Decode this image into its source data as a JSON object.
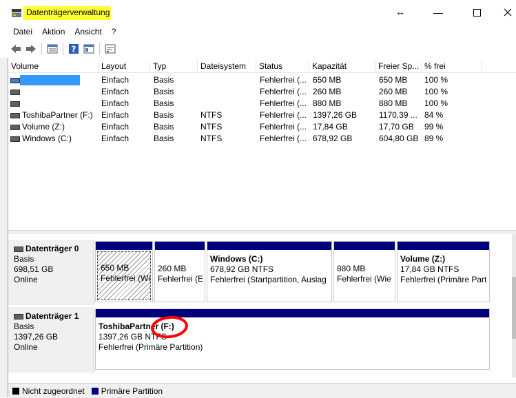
{
  "window": {
    "title": "Datenträgerverwaltung",
    "title_highlight_color": "#ffff33",
    "controls": [
      "minimize",
      "maximize",
      "close"
    ]
  },
  "menu": [
    {
      "label": "Datei"
    },
    {
      "label": "Aktion"
    },
    {
      "label": "Ansicht"
    },
    {
      "label": "?"
    }
  ],
  "toolbar": {
    "buttons": [
      "back-icon",
      "forward-icon",
      "disk-list-icon",
      "help-icon",
      "properties-icon",
      "settings-icon"
    ]
  },
  "volume_table": {
    "columns": [
      "Volume",
      "Layout",
      "Typ",
      "Dateisystem",
      "Status",
      "Kapazität",
      "Freier Sp...",
      "% frei"
    ],
    "rows": [
      {
        "volume": "",
        "layout": "Einfach",
        "typ": "Basis",
        "fs": "",
        "status": "Fehlerfrei (...",
        "cap": "650 MB",
        "free": "650 MB",
        "pct": "100 %",
        "selected": true
      },
      {
        "volume": "",
        "layout": "Einfach",
        "typ": "Basis",
        "fs": "",
        "status": "Fehlerfrei (...",
        "cap": "260 MB",
        "free": "260 MB",
        "pct": "100 %",
        "selected": false
      },
      {
        "volume": "",
        "layout": "Einfach",
        "typ": "Basis",
        "fs": "",
        "status": "Fehlerfrei (...",
        "cap": "880 MB",
        "free": "880 MB",
        "pct": "100 %",
        "selected": false
      },
      {
        "volume": "ToshibaPartner (F:)",
        "layout": "Einfach",
        "typ": "Basis",
        "fs": "NTFS",
        "status": "Fehlerfrei (...",
        "cap": "1397,26 GB",
        "free": "1170,39 ...",
        "pct": "84 %",
        "selected": false
      },
      {
        "volume": "Volume (Z:)",
        "layout": "Einfach",
        "typ": "Basis",
        "fs": "NTFS",
        "status": "Fehlerfrei (...",
        "cap": "17,84 GB",
        "free": "17,70 GB",
        "pct": "99 %",
        "selected": false
      },
      {
        "volume": "Windows (C:)",
        "layout": "Einfach",
        "typ": "Basis",
        "fs": "NTFS",
        "status": "Fehlerfrei (...",
        "cap": "678,92 GB",
        "free": "604,80 GB",
        "pct": "89 %",
        "selected": false
      }
    ]
  },
  "disks": [
    {
      "name": "Datenträger 0",
      "type": "Basis",
      "size": "698,51 GB",
      "state": "Online",
      "partitions": [
        {
          "name": "",
          "line1": "650 MB",
          "line2": "Fehlerfrei (Wie",
          "selected": true
        },
        {
          "name": "",
          "line1": "260 MB",
          "line2": "Fehlerfrei (E",
          "selected": false
        },
        {
          "name": "Windows  (C:)",
          "line1": "678,92 GB NTFS",
          "line2": "Fehlerfrei (Startpartition, Auslag",
          "selected": false
        },
        {
          "name": "",
          "line1": "880 MB",
          "line2": "Fehlerfrei (Wie",
          "selected": false
        },
        {
          "name": "Volume  (Z:)",
          "line1": "17,84 GB NTFS",
          "line2": "Fehlerfrei (Primäre Part",
          "selected": false
        }
      ]
    },
    {
      "name": "Datenträger 1",
      "type": "Basis",
      "size": "1397,26 GB",
      "state": "Online",
      "partitions": [
        {
          "name": "ToshibaPartner  (F:)",
          "line1": "1397,26 GB NTFS",
          "line2": "Fehlerfrei (Primäre Partition)",
          "selected": false
        }
      ]
    }
  ],
  "legend": [
    {
      "label": "Nicht zugeordnet",
      "color": "#000000"
    },
    {
      "label": "Primäre Partition",
      "color": "#00007f"
    }
  ],
  "colors": {
    "primary_partition": "#00007f",
    "selection": "#3399ff",
    "annotation_circle": "#ff0000"
  }
}
